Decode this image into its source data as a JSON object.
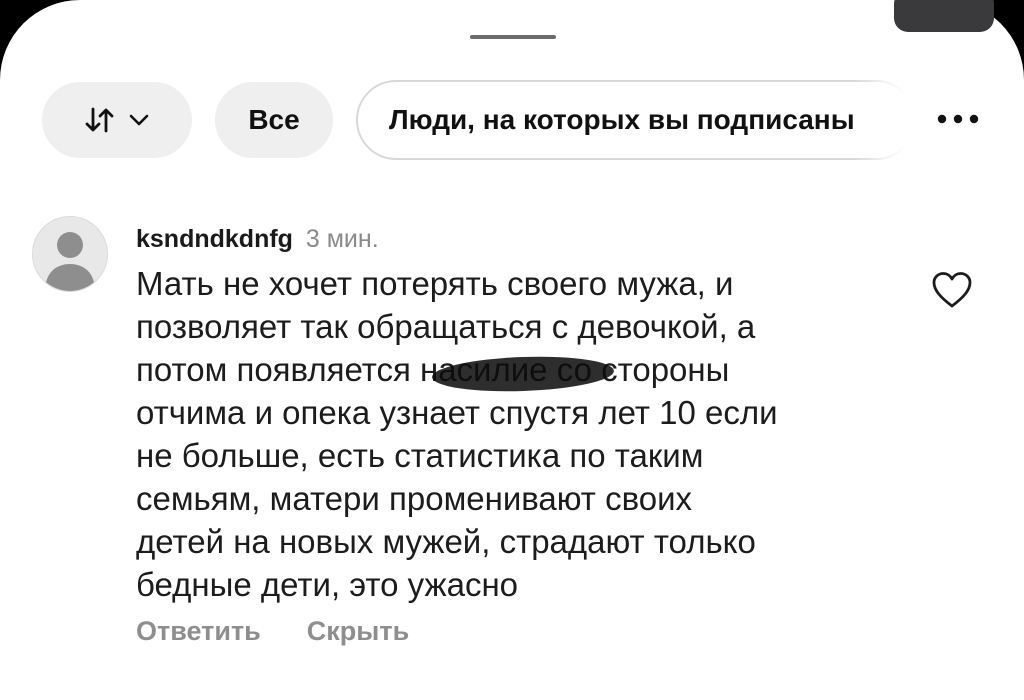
{
  "filters": {
    "sort_icon": "sort-arrows-icon",
    "sort_chevron_icon": "chevron-down-icon",
    "all_label": "Все",
    "following_label": "Люди, на которых вы подписаны",
    "more_icon": "more-horizontal-icon"
  },
  "comment": {
    "avatar_icon": "default-avatar-icon",
    "username": "ksndndkdnfg",
    "time": "3 мин.",
    "text": "Мать не хочет потерять своего мужа, и\nпозволяет так обращаться с девочкой, а\nпотом появляется насилие со стороны\nотчима и опека узнает спустя лет 10 если\nне больше, есть статистика по таким\nсемьям, матери променивают своих\nдетей на новых мужей, страдают только\nбедные дети, это ужасно",
    "like_icon": "heart-outline-icon",
    "reply_label": "Ответить",
    "hide_label": "Скрыть"
  },
  "colors": {
    "pill_background": "#efefef",
    "secondary_text": "#8a8a8a",
    "primary_text": "#1c1c1c"
  }
}
